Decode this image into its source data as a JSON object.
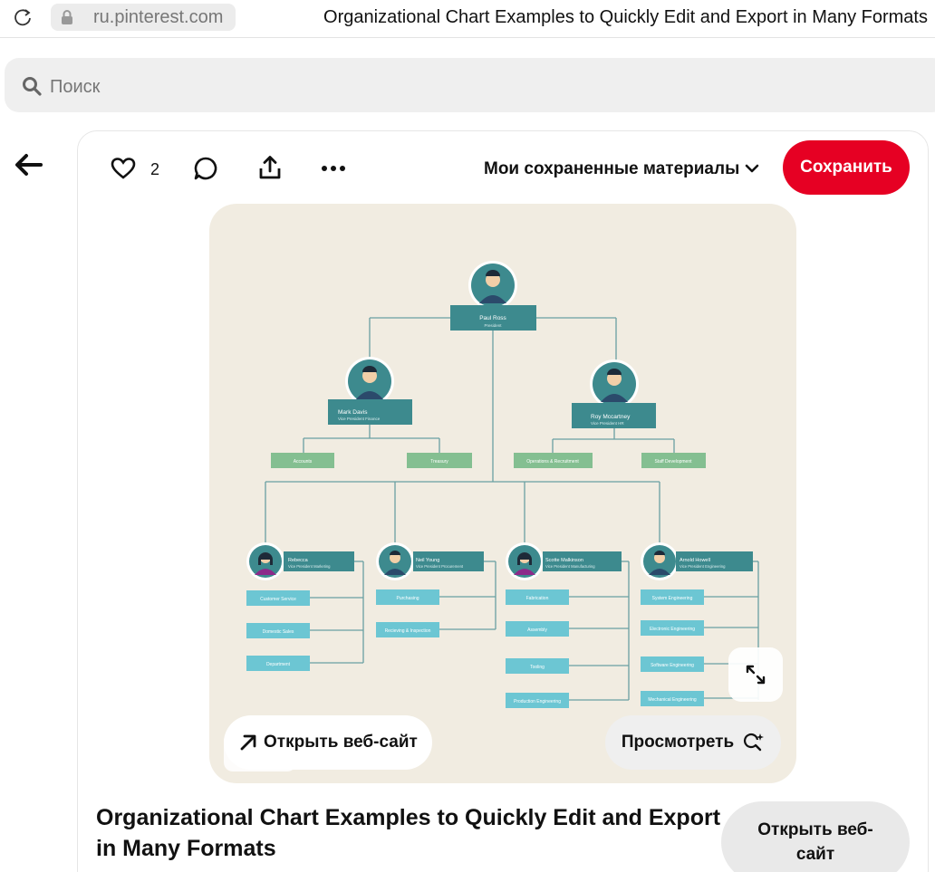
{
  "browser": {
    "url": "ru.pinterest.com",
    "page_title": "Organizational Chart Examples to Quickly Edit and Export in Many Formats"
  },
  "search": {
    "placeholder": "Поиск"
  },
  "actions": {
    "likes_count": "2"
  },
  "board": {
    "label": "Мои сохраненные материалы"
  },
  "save_button": {
    "label": "Сохранить"
  },
  "colors": {
    "brand_red": "#e60023",
    "chart_bg": "#f1ece1",
    "teal": "#3d8a8e",
    "green": "#84bf91",
    "cyan": "#6cc6d3"
  },
  "org_chart": {
    "president": {
      "name": "Paul Ross",
      "role": "President"
    },
    "vps_top": [
      {
        "name": "Mark Davis",
        "role": "Vice President Finance",
        "units": [
          "Accounts",
          "Treasury"
        ]
      },
      {
        "name": "Roy Mccartney",
        "role": "Vice President HR",
        "units": [
          "Operations & Recruitment",
          "Staff Development"
        ]
      }
    ],
    "vps_bottom": [
      {
        "name": "Rebecca",
        "role": "Vice President Marketing",
        "units": [
          "Customer Service",
          "Domestic Sales",
          "Department"
        ]
      },
      {
        "name": "Neil Young",
        "role": "Vice President Procurement",
        "units": [
          "Purchasing",
          "Recieving & Inspection"
        ]
      },
      {
        "name": "Scotte Malkinson",
        "role": "Vice President Manufacturing",
        "units": [
          "Fabrication",
          "Assembly",
          "Tooling",
          "Production Engineering"
        ]
      },
      {
        "name": "Arnold Howell",
        "role": "Vice President Engineering",
        "units": [
          "System Engineering",
          "Electronic Engineering",
          "Software Engineering",
          "Mechanical Engineering"
        ]
      }
    ]
  },
  "image_actions": {
    "open_site": "Открыть веб-сайт",
    "view": "Просмотреть"
  },
  "pin": {
    "title": "Organizational Chart Examples to Quickly Edit and Export in Many Formats",
    "open_site_button": "Открыть веб-сайт"
  }
}
